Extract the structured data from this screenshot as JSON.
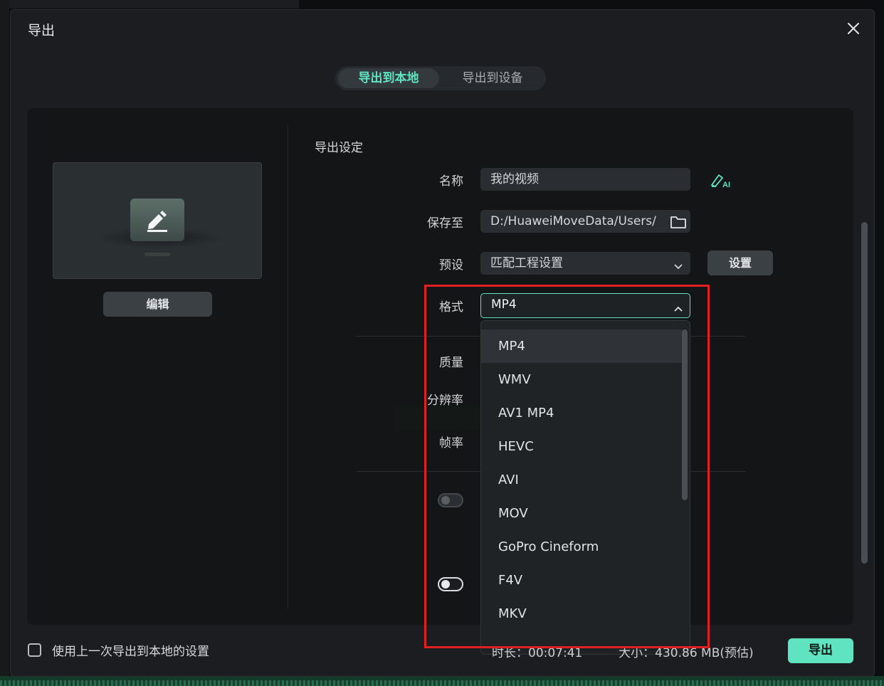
{
  "dialog": {
    "title": "导出",
    "close_icon": "close-icon"
  },
  "tabs": [
    {
      "label": "导出到本地",
      "active": true
    },
    {
      "label": "导出到设备",
      "active": false
    }
  ],
  "preview": {
    "edit_label": "编辑",
    "icon": "pencil-icon"
  },
  "settings": {
    "section_title": "导出设定",
    "name_label": "名称",
    "name_value": "我的视频",
    "ai_icon": "ai-pen-icon",
    "save_label": "保存至",
    "save_value": "D:/HuaweiMoveData/Users/",
    "folder_icon": "folder-icon",
    "preset_label": "预设",
    "preset_value": "匹配工程设置",
    "preset_button": "设置",
    "format_label": "格式",
    "format_value": "MP4",
    "quality_label": "质量",
    "resolution_label": "分辨率",
    "framerate_label": "帧率"
  },
  "format_options": [
    "MP4",
    "WMV",
    "AV1 MP4",
    "HEVC",
    "AVI",
    "MOV",
    "GoPro Cineform",
    "F4V",
    "MKV"
  ],
  "format_selected_index": 0,
  "toggles": [
    {
      "on": false
    },
    {
      "on": true
    }
  ],
  "footer": {
    "checkbox_label": "使用上一次导出到本地的设置",
    "duration_label": "时长：",
    "duration_value": "00:07:41",
    "size_label": "大小：",
    "size_value": "430.86 MB(预估)",
    "export_button": "导出"
  },
  "colors": {
    "accent": "#5fe3c0",
    "highlight": "#e02020"
  }
}
